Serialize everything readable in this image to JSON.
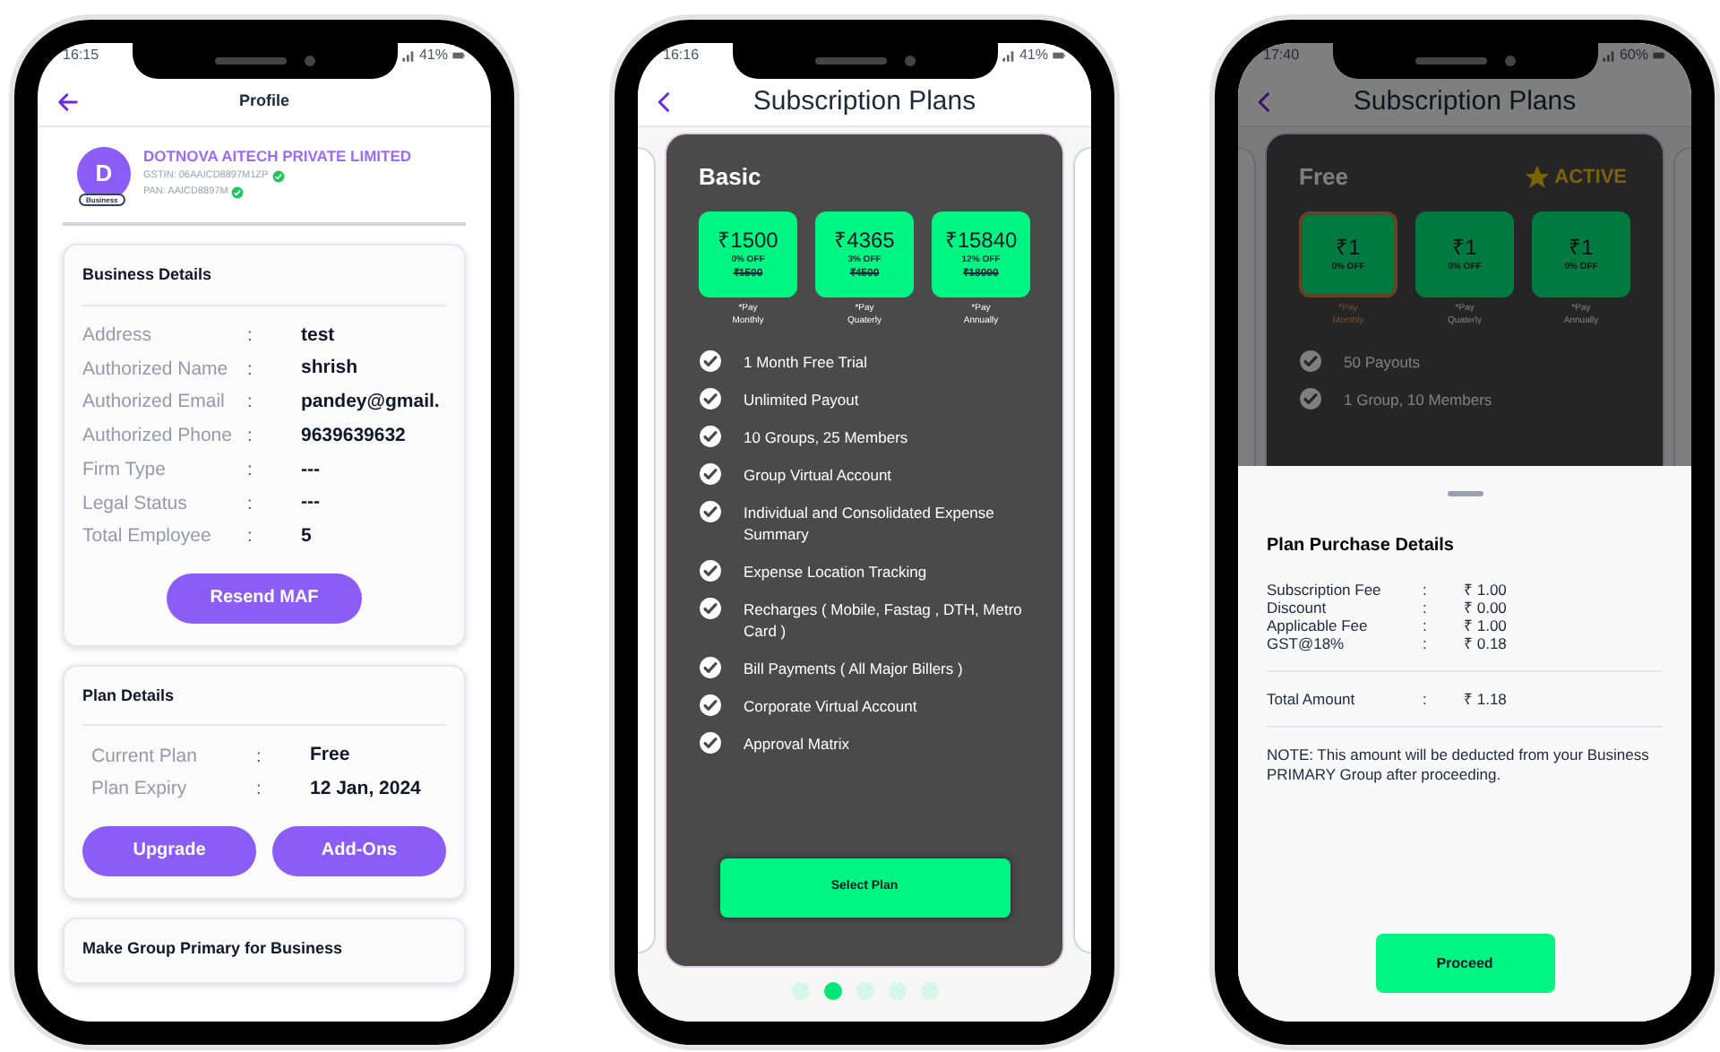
{
  "phones": [
    {
      "kind": "profile",
      "status": {
        "time": "16:15",
        "battery": "41%"
      },
      "header": {
        "title": "Profile"
      },
      "company": {
        "avatar_letter": "D",
        "avatar_tag": "Business",
        "name": "DOTNOVA AITECH PRIVATE LIMITED",
        "ids": [
          {
            "text": "GSTIN: 06AAICD8897M1ZP",
            "verified": true
          },
          {
            "text": "PAN: AAICD8897M",
            "verified": true
          }
        ]
      },
      "cards": [
        {
          "title": "Business Details",
          "rows": [
            {
              "label": "Address",
              "sep": ":",
              "value": "test"
            },
            {
              "label": "Authorized Name",
              "sep": ":",
              "value": "shrish"
            },
            {
              "label": "Authorized Email",
              "sep": ":",
              "value": "pandey@gmail."
            },
            {
              "label": "Authorized Phone",
              "sep": ":",
              "value": "9639639632"
            },
            {
              "label": "Firm Type",
              "sep": ":",
              "value": "---"
            },
            {
              "label": "Legal Status",
              "sep": ":",
              "value": "---"
            },
            {
              "label": "Total Employee",
              "sep": ":",
              "value": "5"
            }
          ],
          "buttons": [
            "Resend MAF"
          ]
        },
        {
          "title": "Plan Details",
          "rows": [
            {
              "label": "Current Plan",
              "sep": ":",
              "value": "Free"
            },
            {
              "label": "Plan Expiry",
              "sep": ":",
              "value": "12 Jan, 2024"
            }
          ],
          "buttons": [
            "Upgrade",
            "Add-Ons"
          ]
        },
        {
          "title": "Make Group Primary for Business"
        }
      ]
    },
    {
      "kind": "plans",
      "status": {
        "time": "16:16",
        "battery": "41%"
      },
      "header": {
        "title": "Subscription Plans"
      },
      "plan": {
        "name": "Basic",
        "tiles": [
          {
            "price": "₹1500",
            "discount": "0% OFF",
            "original": "₹1500",
            "caption": "*Pay\nMonthly",
            "selected": false
          },
          {
            "price": "₹4365",
            "discount": "3% OFF",
            "original": "₹4500",
            "caption": "*Pay\nQuaterly",
            "selected": false
          },
          {
            "price": "₹15840",
            "discount": "12% OFF",
            "original": "₹18000",
            "caption": "*Pay\nAnnually",
            "selected": false
          }
        ],
        "features": [
          "1 Month Free Trial",
          "Unlimited Payout",
          "10 Groups, 25 Members",
          "Group Virtual Account",
          "Individual and Consolidated Expense Summary",
          "Expense Location Tracking",
          "Recharges ( Mobile, Fastag , DTH, Metro Card )",
          "Bill Payments ( All Major Billers )",
          "Corporate Virtual Account",
          "Approval Matrix"
        ],
        "button": "Select Plan"
      },
      "pager": [
        {
          "selected": false
        },
        {
          "selected": true
        },
        {
          "selected": false
        },
        {
          "selected": false
        },
        {
          "selected": false
        }
      ]
    },
    {
      "kind": "purchase",
      "status": {
        "time": "17:40",
        "battery": "60%"
      },
      "header": {
        "title": "Subscription Plans"
      },
      "plan": {
        "name": "Free",
        "badge": "ACTIVE",
        "tiles": [
          {
            "price": "₹1",
            "discount": "0% OFF",
            "caption": "*Pay\nMonthly",
            "selected": true
          },
          {
            "price": "₹1",
            "discount": "0% OFF",
            "caption": "*Pay\nQuaterly",
            "selected": false
          },
          {
            "price": "₹1",
            "discount": "0% OFF",
            "caption": "*Pay\nAnnually",
            "selected": false
          }
        ],
        "features": [
          "50 Payouts",
          "1 Group, 10 Members"
        ]
      },
      "sheet": {
        "title": "Plan Purchase Details",
        "rows": [
          {
            "label": "Subscription Fee",
            "sep": ":",
            "value": "₹ 1.00"
          },
          {
            "label": "Discount",
            "sep": ":",
            "value": "₹ 0.00"
          },
          {
            "label": "Applicable Fee",
            "sep": ":",
            "value": "₹ 1.00"
          },
          {
            "label": "GST@18%",
            "sep": ":",
            "value": "₹ 0.18"
          }
        ],
        "total": {
          "label": "Total Amount",
          "sep": ":",
          "value": "₹ 1.18"
        },
        "note": "NOTE: This amount will be deducted from your Business PRIMARY Group after proceeding.",
        "button": "Proceed"
      }
    }
  ]
}
